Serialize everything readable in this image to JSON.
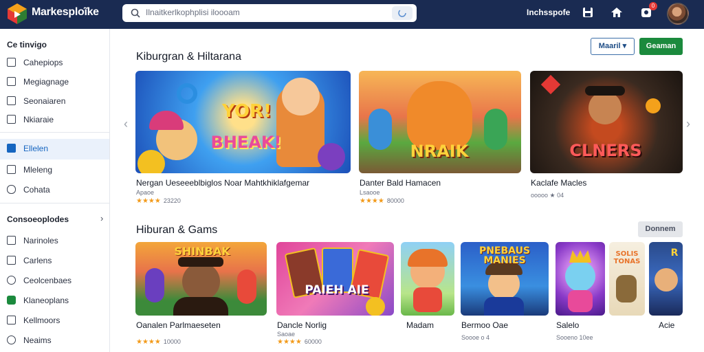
{
  "app": {
    "brand": "Markesploĩke"
  },
  "search": {
    "placeholder": "Ilnaitkerlkophplisi iloooam"
  },
  "topbar": {
    "link": "Inchsspofe",
    "notification_count": "0"
  },
  "sidebar": {
    "heading": "Ce tinvigo",
    "items_top": [
      {
        "label": "Cahepiops",
        "icon": "gamepad-icon"
      },
      {
        "label": "Megiagnage",
        "icon": "list-icon"
      },
      {
        "label": "Seonaiaren",
        "icon": "box-icon"
      },
      {
        "label": "Nkiaraie",
        "icon": "flag-icon"
      }
    ],
    "items_mid": [
      {
        "label": "Ellelen",
        "icon": "check-icon",
        "active": true
      },
      {
        "label": "Mleleng",
        "icon": "check-icon"
      },
      {
        "label": "Cohata",
        "icon": "chat-icon"
      }
    ],
    "section2": "Consoeoplodes",
    "items_bottom": [
      {
        "label": "Narinoles",
        "icon": "list-icon"
      },
      {
        "label": "Carlens",
        "icon": "tag-icon"
      },
      {
        "label": "Ceolcenbaes",
        "icon": "check-circle-icon"
      },
      {
        "label": "Klaneoplans",
        "icon": "check-icon",
        "green": true
      },
      {
        "label": "Kellmoors",
        "icon": "tag-icon"
      },
      {
        "label": "Neaims",
        "icon": "alert-circle-icon"
      }
    ]
  },
  "section1": {
    "title": "Kiburgran & Hiltarana",
    "btn_outline": "Maaril",
    "btn_green": "Geaman",
    "cards": [
      {
        "title": "Nergan Ueseeeblbiglos Noar Mahtkhiklafgemar",
        "sub": "Apaoe",
        "stars": "★★★★",
        "rating": "23220",
        "art": "YOR!\nBHEAK!"
      },
      {
        "title": "Danter Bald Hamacen",
        "sub": "Lsaooe",
        "stars": "★★★★",
        "rating": "80000",
        "art": "NRAIK"
      },
      {
        "title": "Kaclafe Macles",
        "sub": "ooooo ★ 04",
        "stars": "",
        "rating": "",
        "art": "CLNERS"
      }
    ]
  },
  "section2": {
    "title": "Hiburan & Gams",
    "btn_grey": "Donnem",
    "cards": [
      {
        "title": "Oanalen Parlmaeseten",
        "sub": "",
        "stars": "★★★★",
        "rating": "10000",
        "art": "SHINBAK"
      },
      {
        "title": "Dancle Norlig",
        "sub": "Saoae",
        "stars": "★★★★",
        "rating": "60000",
        "art": "PAIEH AIE"
      },
      {
        "title": "Madam",
        "sub": "",
        "stars": "",
        "rating": "",
        "art": ""
      },
      {
        "title": "Bermoo Oae",
        "sub": "Soooe o 4",
        "stars": "",
        "rating": "",
        "art": "PNEBAUS MANIES"
      },
      {
        "title": "Salelo",
        "sub": "Sooeno 10ee",
        "stars": "",
        "rating": "",
        "art": ""
      },
      {
        "title": "",
        "sub": "",
        "stars": "",
        "rating": "",
        "art": "SOLIS TONAS"
      },
      {
        "title": "Acie",
        "sub": "",
        "stars": "",
        "rating": "",
        "art": ""
      }
    ]
  }
}
